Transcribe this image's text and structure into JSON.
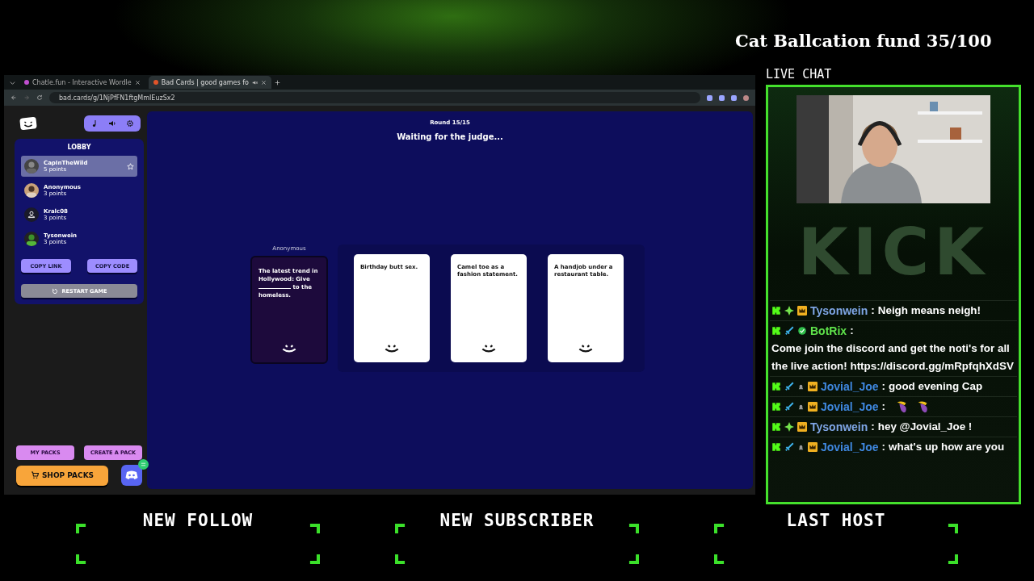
{
  "overlay": {
    "goal": "Cat Ballcation fund 35/100",
    "chat_label": "LIVE CHAT",
    "logo_text": "KICK"
  },
  "browser": {
    "tabs": [
      {
        "title": "Chatle.fun - Interactive Wordle",
        "selected": false,
        "muted": false
      },
      {
        "title": "Bad Cards | good games fo",
        "selected": true,
        "muted": true
      }
    ],
    "url": "bad.cards/g/1NjPfFN1ftgMmIEuzSx2"
  },
  "lobby": {
    "title": "LOBBY",
    "players": [
      {
        "name": "CapInTheWild",
        "points": "5 points",
        "selected": true,
        "host": true
      },
      {
        "name": "Anonymous",
        "points": "3 points",
        "selected": false,
        "host": false
      },
      {
        "name": "Kralc08",
        "points": "3 points",
        "selected": false,
        "host": false,
        "avatar": {
          "kind": "default"
        }
      },
      {
        "name": "Tysonwein",
        "points": "3 points",
        "selected": false,
        "host": false
      }
    ],
    "buttons": [
      "COPY LINK",
      "COPY CODE"
    ],
    "restart": "RESTART GAME"
  },
  "footer_buttons": {
    "my_packs": "MY PACKS",
    "create_pack": "CREATE A PACK",
    "shop": "SHOP PACKS"
  },
  "game": {
    "round": "Round 15/15",
    "status": "Waiting for the judge...",
    "judge": "Anonymous",
    "prompt_before": "The latest trend in Hollywood: Give",
    "prompt_after": "to the homeless.",
    "answers": [
      "Birthday butt sex.",
      "Camel toe as a fashion statement.",
      "A handjob under a restaurant table."
    ]
  },
  "chat": [
    {
      "user": "Tysonwein",
      "color": "#7fa6e6",
      "badges": [
        {
          "kind": "kick"
        },
        {
          "kind": "gem"
        },
        {
          "kind": "crown"
        }
      ],
      "separator": ":",
      "text": "Neigh means neigh!"
    },
    {
      "user": "BotRix",
      "color": "#5fe34b",
      "badges": [
        {
          "kind": "kick"
        },
        {
          "kind": "sword"
        },
        {
          "kind": "verified"
        }
      ],
      "separator": ":",
      "text": "Come join the discord and get the noti's for all the live action! https://discord.gg/mRpfqhXdSV"
    },
    {
      "user": "Jovial_Joe",
      "color": "#3f88e0",
      "badges": [
        {
          "kind": "kick"
        },
        {
          "kind": "sword"
        },
        {
          "kind": "bell"
        },
        {
          "kind": "crown"
        }
      ],
      "separator": ":",
      "text": "good evening Cap"
    },
    {
      "user": "Jovial_Joe",
      "color": "#3f88e0",
      "badges": [
        {
          "kind": "kick"
        },
        {
          "kind": "sword"
        },
        {
          "kind": "bell"
        },
        {
          "kind": "crown"
        }
      ],
      "separator": ":",
      "emotes": [
        {
          "kind": "eggplant"
        },
        {
          "kind": "eggplant"
        }
      ]
    },
    {
      "user": "Tysonwein",
      "color": "#7fa6e6",
      "badges": [
        {
          "kind": "kick"
        },
        {
          "kind": "gem"
        },
        {
          "kind": "crown"
        }
      ],
      "separator": ":",
      "text": "hey @Jovial_Joe !"
    },
    {
      "user": "Jovial_Joe",
      "color": "#3f88e0",
      "badges": [
        {
          "kind": "kick"
        },
        {
          "kind": "sword"
        },
        {
          "kind": "bell"
        },
        {
          "kind": "crown"
        }
      ],
      "separator": ":",
      "text": "what's up how are you"
    }
  ],
  "alerts": [
    "NEW FOLLOW",
    "NEW SUBSCRIBER",
    "LAST HOST"
  ]
}
